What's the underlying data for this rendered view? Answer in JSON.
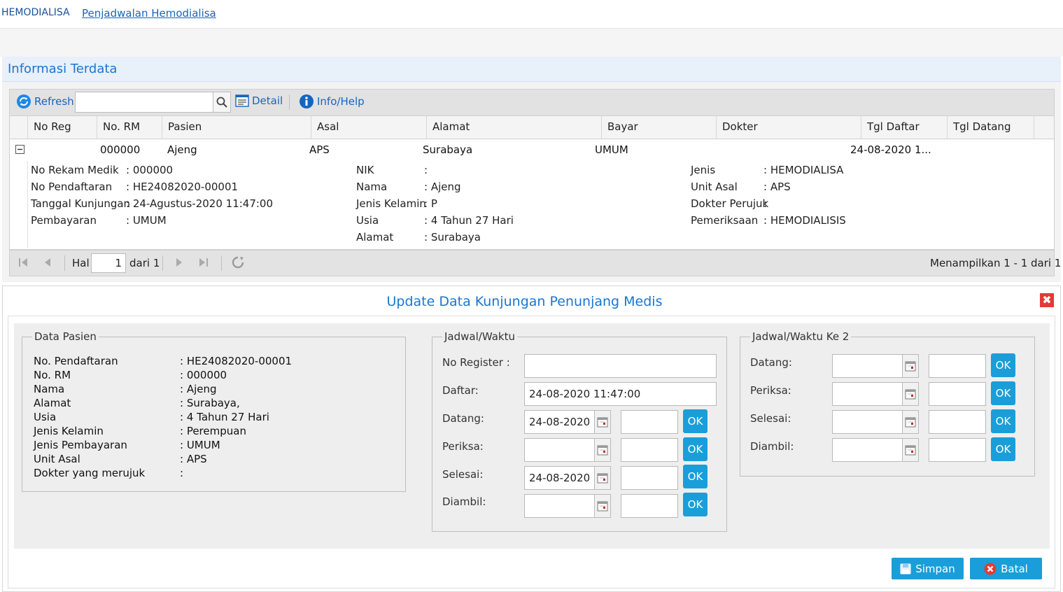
{
  "breadcrumb": {
    "root": "HEMODIALISA",
    "current": "Penjadwalan Hemodialisa"
  },
  "panel": {
    "title": "Informasi Terdata"
  },
  "toolbar": {
    "refresh_label": "Refresh",
    "search_value": "",
    "detail_label": "Detail",
    "info_label": "Info/Help"
  },
  "grid": {
    "columns": [
      "No Reg",
      "No. RM",
      "Pasien",
      "Asal",
      "Alamat",
      "Bayar",
      "Dokter",
      "Tgl Daftar",
      "Tgl Datang"
    ],
    "row": {
      "no_reg": "",
      "no_rm": "000000",
      "pasien": "Ajeng",
      "asal": "APS",
      "alamat": "Surabaya",
      "bayar": "UMUM",
      "dokter": "",
      "tgl_daftar": "24-08-2020 1...",
      "tgl_datang": ""
    },
    "detail": {
      "col1": [
        {
          "label": "No Rekam Medik",
          "value": ": 000000"
        },
        {
          "label": "No Pendaftaran",
          "value": ": HE24082020-00001"
        },
        {
          "label": "Tanggal Kunjungan",
          "value": ": 24-Agustus-2020 11:47:00"
        },
        {
          "label": "Pembayaran",
          "value": ": UMUM"
        }
      ],
      "col2": [
        {
          "label": "NIK",
          "value": ":"
        },
        {
          "label": "Nama",
          "value": ": Ajeng"
        },
        {
          "label": "Jenis Kelamin",
          "value": ": P"
        },
        {
          "label": "Usia",
          "value": ": 4 Tahun 27 Hari"
        },
        {
          "label": "Alamat",
          "value": ": Surabaya"
        }
      ],
      "col3": [
        {
          "label": "Jenis",
          "value": ": HEMODIALISA"
        },
        {
          "label": "Unit Asal",
          "value": ": APS"
        },
        {
          "label": "Dokter Perujuk",
          "value": ":"
        },
        {
          "label": "Pemeriksaan",
          "value": ": HEMODIALISIS"
        }
      ]
    }
  },
  "pager": {
    "hal_label": "Hal",
    "page": "1",
    "of_label": "dari 1",
    "summary": "Menampilkan 1 - 1 dari 1"
  },
  "modal": {
    "title": "Update Data Kunjungan Penunjang Medis",
    "close_glyph": "✖",
    "patient": {
      "legend": "Data Pasien",
      "rows": [
        {
          "label": "No. Pendaftaran",
          "value": ": HE24082020-00001"
        },
        {
          "label": "No. RM",
          "value": ": 000000"
        },
        {
          "label": "Nama",
          "value": ": Ajeng"
        },
        {
          "label": "Alamat",
          "value": ": Surabaya,"
        },
        {
          "label": "Usia",
          "value": ": 4 Tahun 27 Hari"
        },
        {
          "label": "Jenis Kelamin",
          "value": ": Perempuan"
        },
        {
          "label": "Jenis Pembayaran",
          "value": ": UMUM"
        },
        {
          "label": "Unit Asal",
          "value": ": APS"
        },
        {
          "label": "Dokter yang merujuk",
          "value": ":"
        }
      ]
    },
    "schedule": {
      "legend": "Jadwal/Waktu",
      "no_register_label": "No Register :",
      "no_register_value": "",
      "daftar_label": "Daftar:",
      "daftar_value": "24-08-2020 11:47:00",
      "rows": [
        {
          "label": "Datang:",
          "date": "24-08-2020",
          "time": "",
          "ok": "OK"
        },
        {
          "label": "Periksa:",
          "date": "",
          "time": "",
          "ok": "OK"
        },
        {
          "label": "Selesai:",
          "date": "24-08-2020",
          "time": "",
          "ok": "OK"
        },
        {
          "label": "Diambil:",
          "date": "",
          "time": "",
          "ok": "OK"
        }
      ]
    },
    "schedule2": {
      "legend": "Jadwal/Waktu Ke 2",
      "rows": [
        {
          "label": "Datang:",
          "date": "",
          "time": "",
          "ok": "OK"
        },
        {
          "label": "Periksa:",
          "date": "",
          "time": "",
          "ok": "OK"
        },
        {
          "label": "Selesai:",
          "date": "",
          "time": "",
          "ok": "OK"
        },
        {
          "label": "Diambil:",
          "date": "",
          "time": "",
          "ok": "OK"
        }
      ]
    },
    "save_label": "Simpan",
    "cancel_label": "Batal"
  },
  "colors": {
    "accent": "#1a9ed9",
    "link": "#1565c0",
    "close": "#e53935"
  }
}
